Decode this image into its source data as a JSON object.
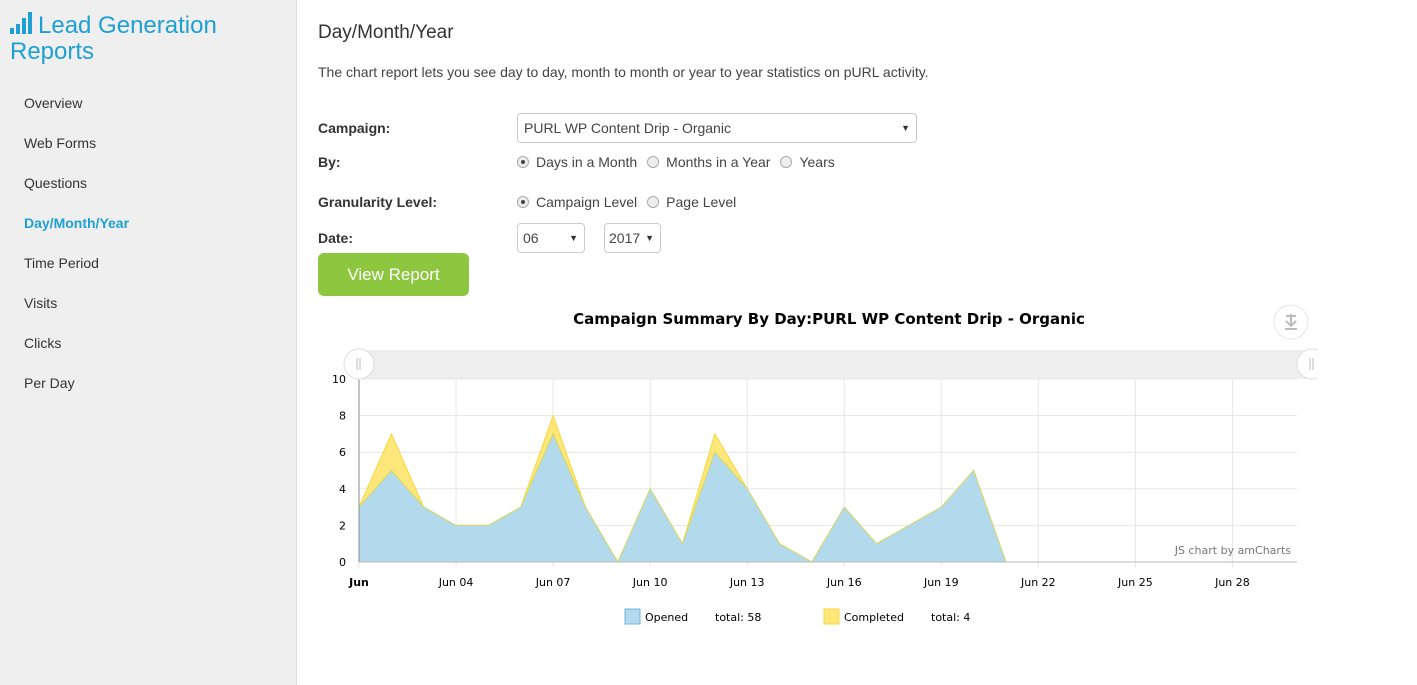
{
  "sidebar": {
    "brand": "Lead Generation Reports",
    "brand_icon": "bar-chart-icon",
    "items": [
      {
        "label": "Overview",
        "active": false
      },
      {
        "label": "Web Forms",
        "active": false
      },
      {
        "label": "Questions",
        "active": false
      },
      {
        "label": "Day/Month/Year",
        "active": true
      },
      {
        "label": "Time Period",
        "active": false
      },
      {
        "label": "Visits",
        "active": false
      },
      {
        "label": "Clicks",
        "active": false
      },
      {
        "label": "Per Day",
        "active": false
      }
    ]
  },
  "main": {
    "title": "Day/Month/Year",
    "description": "The chart report lets you see day to day, month to month or year to year statistics on pURL activity.",
    "campaign_label": "Campaign:",
    "campaign_value": "PURL WP Content Drip - Organic",
    "by_label": "By:",
    "by_options": [
      {
        "label": "Days in a Month",
        "checked": true
      },
      {
        "label": "Months in a Year",
        "checked": false
      },
      {
        "label": "Years",
        "checked": false
      }
    ],
    "granularity_label": "Granularity Level:",
    "granularity_options": [
      {
        "label": "Campaign Level",
        "checked": true
      },
      {
        "label": "Page Level",
        "checked": false
      }
    ],
    "date_label": "Date:",
    "month_value": "06",
    "year_value": "2017",
    "view_report_label": "View Report"
  },
  "chart_data": {
    "type": "area",
    "stacked": true,
    "title": "Campaign Summary By Day:PURL WP Content Drip - Organic",
    "xlabel": "",
    "ylabel": "",
    "ylim": [
      0,
      10
    ],
    "yticks": [
      0,
      2,
      4,
      6,
      8,
      10
    ],
    "x": [
      "Jun 01",
      "Jun 02",
      "Jun 03",
      "Jun 04",
      "Jun 05",
      "Jun 06",
      "Jun 07",
      "Jun 08",
      "Jun 09",
      "Jun 10",
      "Jun 11",
      "Jun 12",
      "Jun 13",
      "Jun 14",
      "Jun 15",
      "Jun 16",
      "Jun 17",
      "Jun 18",
      "Jun 19",
      "Jun 20",
      "Jun 21",
      "Jun 22",
      "Jun 23",
      "Jun 24",
      "Jun 25",
      "Jun 26",
      "Jun 27",
      "Jun 28",
      "Jun 29",
      "Jun 30"
    ],
    "xticks": [
      {
        "day": 1,
        "label": "Jun",
        "bold": true
      },
      {
        "day": 4,
        "label": "Jun 04"
      },
      {
        "day": 7,
        "label": "Jun 07"
      },
      {
        "day": 10,
        "label": "Jun 10"
      },
      {
        "day": 13,
        "label": "Jun 13"
      },
      {
        "day": 16,
        "label": "Jun 16"
      },
      {
        "day": 19,
        "label": "Jun 19"
      },
      {
        "day": 22,
        "label": "Jun 22"
      },
      {
        "day": 25,
        "label": "Jun 25"
      },
      {
        "day": 28,
        "label": "Jun 28"
      }
    ],
    "data_end_day": 21,
    "series": [
      {
        "name": "Opened",
        "color": "#b3d9ec",
        "stroke": "#d4d86a",
        "total_label": "total: 58",
        "values": [
          3,
          5,
          3,
          2,
          2,
          3,
          7,
          3,
          0,
          4,
          1,
          6,
          4,
          1,
          0,
          3,
          1,
          2,
          3,
          5,
          0
        ]
      },
      {
        "name": "Completed",
        "color": "#fde67a",
        "stroke": "#f5d83c",
        "total_label": "total: 4",
        "values": [
          0,
          2,
          0,
          0,
          0,
          0,
          1,
          0,
          0,
          0,
          0,
          1,
          0,
          0,
          0,
          0,
          0,
          0,
          0,
          0,
          0
        ]
      }
    ],
    "grid": true,
    "legend": "bottom",
    "credit": "JS chart by amCharts"
  }
}
